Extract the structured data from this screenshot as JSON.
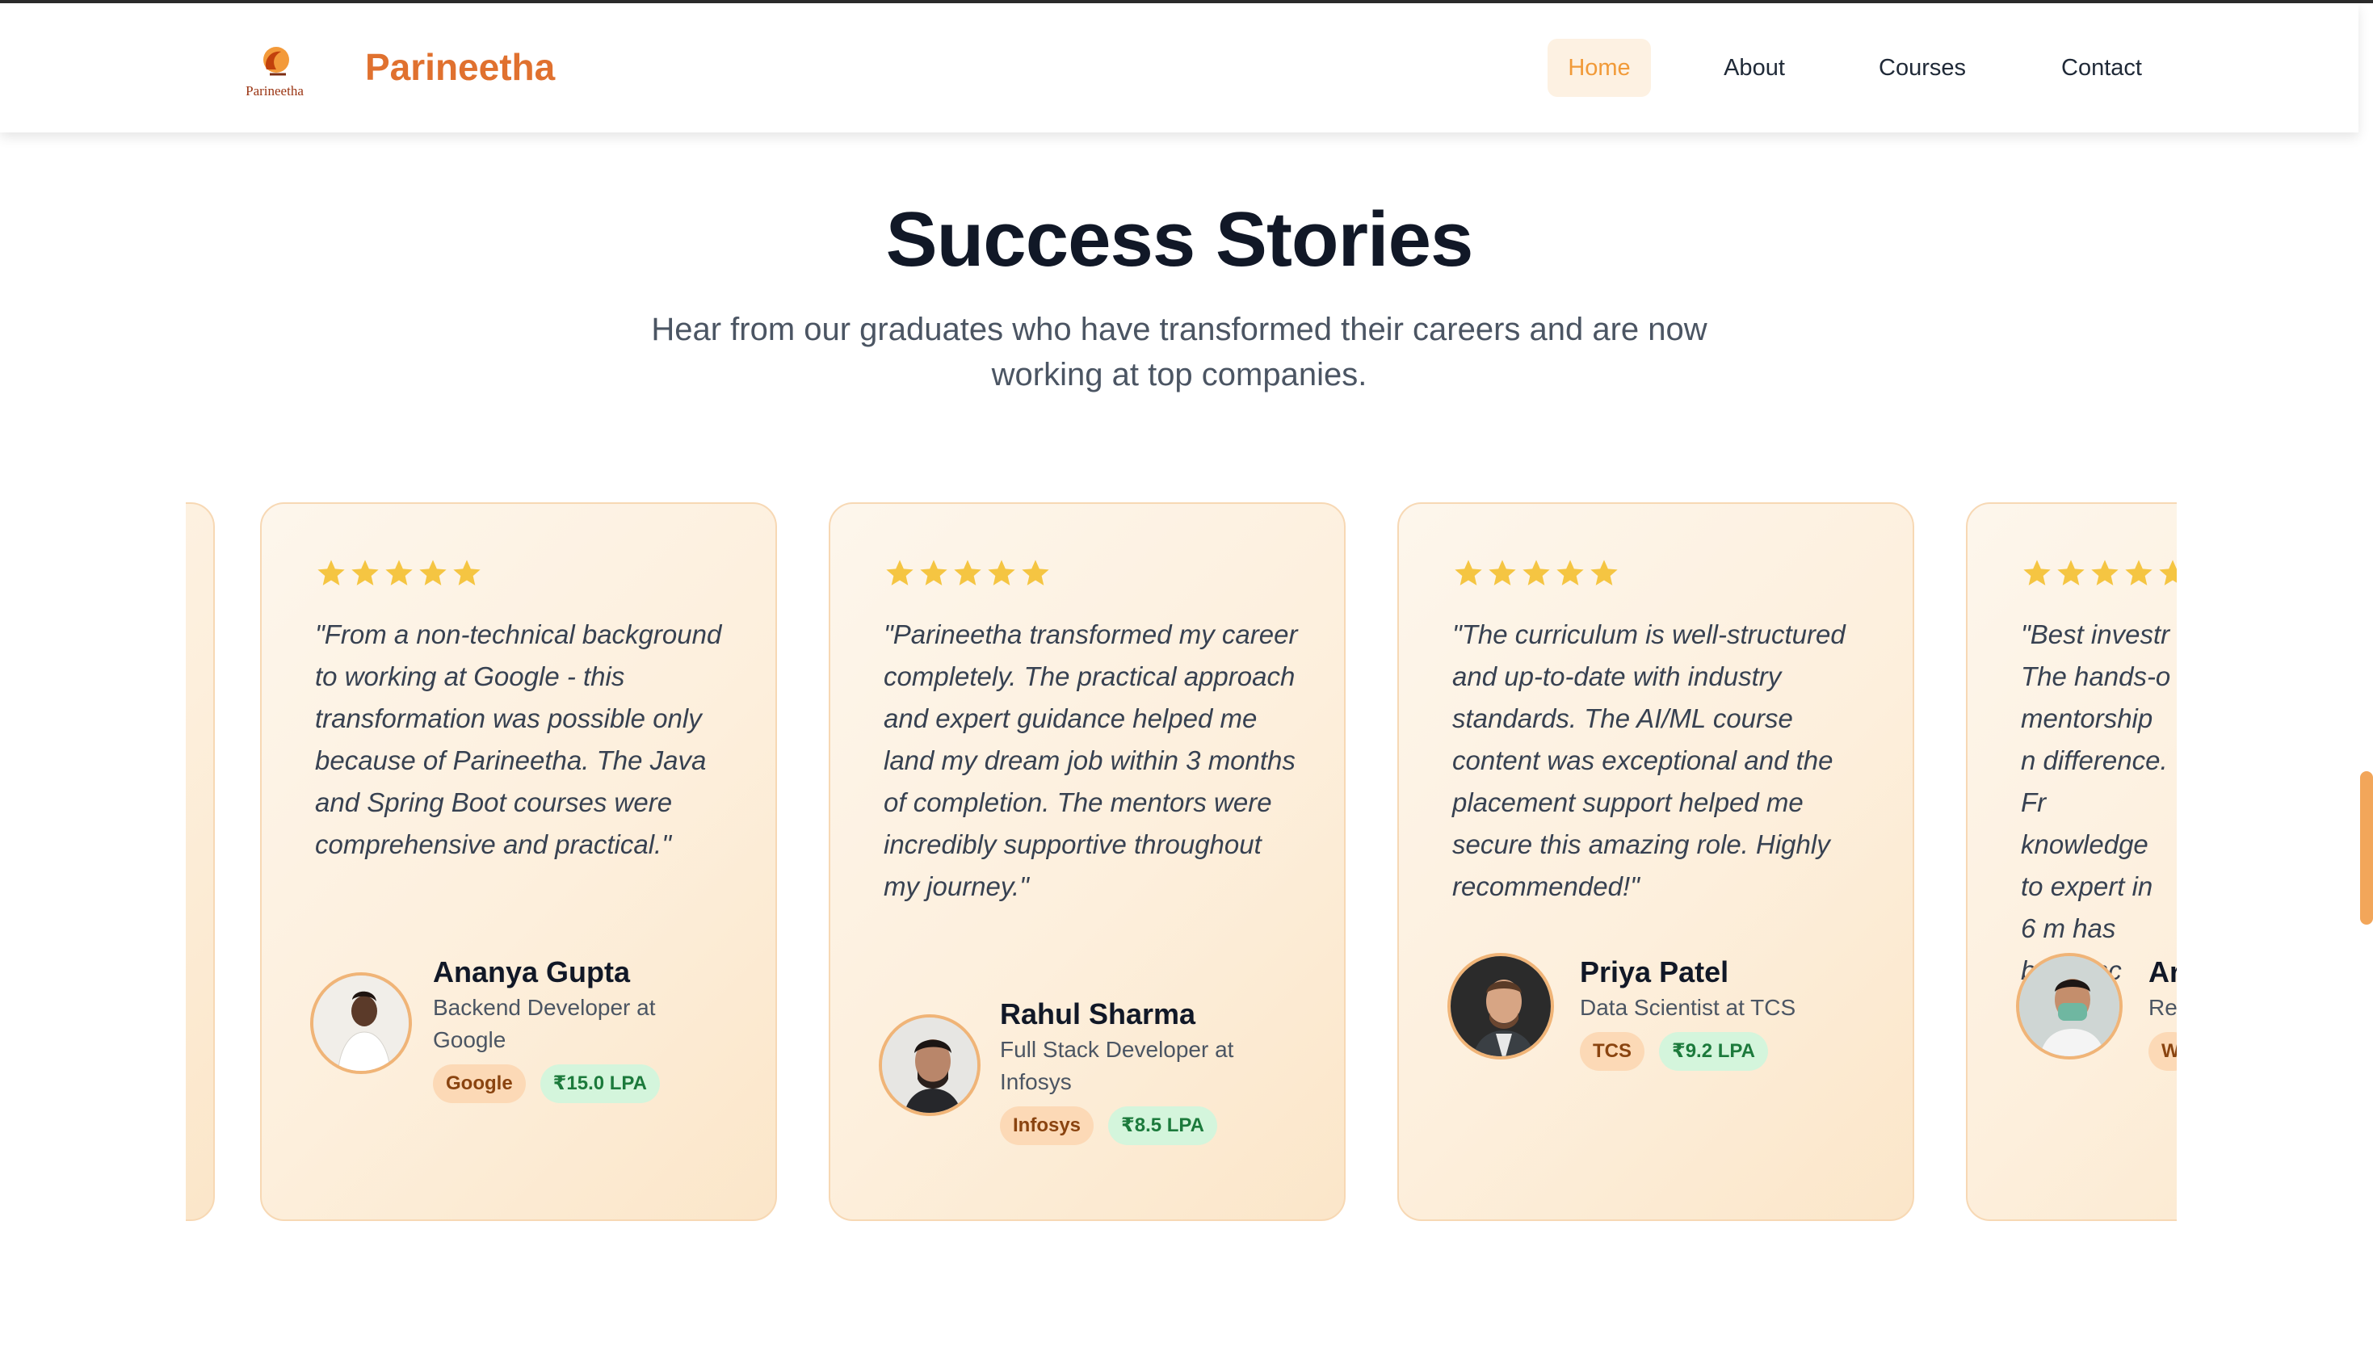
{
  "header": {
    "logo_text": "Parineetha",
    "brand": "Parineetha",
    "nav": [
      {
        "label": "Home",
        "active": true
      },
      {
        "label": "About",
        "active": false
      },
      {
        "label": "Courses",
        "active": false
      },
      {
        "label": "Contact",
        "active": false
      }
    ]
  },
  "section": {
    "title": "Success Stories",
    "subtitle": "Hear from our graduates who have transformed their careers and are now working at top companies."
  },
  "testimonials": [
    {
      "rating": 5,
      "quote": "\"From a non-technical background to working at Google - this transformation was possible only because of Parineetha. The Java and Spring Boot courses were comprehensive and practical.\"",
      "name": "Ananya Gupta",
      "role": "Backend Developer at Google",
      "company": "Google",
      "salary": "₹15.0 LPA"
    },
    {
      "rating": 5,
      "quote": "\"Parineetha transformed my career completely. The practical approach and expert guidance helped me land my dream job within 3 months of completion. The mentors were incredibly supportive throughout my journey.\"",
      "name": "Rahul Sharma",
      "role": "Full Stack Developer at Infosys",
      "company": "Infosys",
      "salary": "₹8.5 LPA"
    },
    {
      "rating": 5,
      "quote": "\"The curriculum is well-structured and up-to-date with industry standards. The AI/ML course content was exceptional and the placement support helped me secure this amazing role. Highly recommended!\"",
      "name": "Priya Patel",
      "role": "Data Scientist at TCS",
      "company": "TCS",
      "salary": "₹9.2 LPA"
    },
    {
      "rating": 5,
      "quote_visible": "\"Best investr The hands-o mentorship n difference. Fr knowledge to expert in 6 m has been inc",
      "name_visible": "Ar",
      "role_visible": "Re",
      "company_visible": "W"
    }
  ],
  "colors": {
    "brand": "#e0712f",
    "nav_active_bg": "#fdf1e2",
    "nav_active_text": "#f19a38",
    "star": "#f5c542",
    "card_border": "#f7d8b4",
    "tag_company_bg": "#fcd9b6",
    "tag_salary_bg": "#d4f5dc"
  },
  "icons": [
    "parineetha-logo",
    "star-icon"
  ]
}
